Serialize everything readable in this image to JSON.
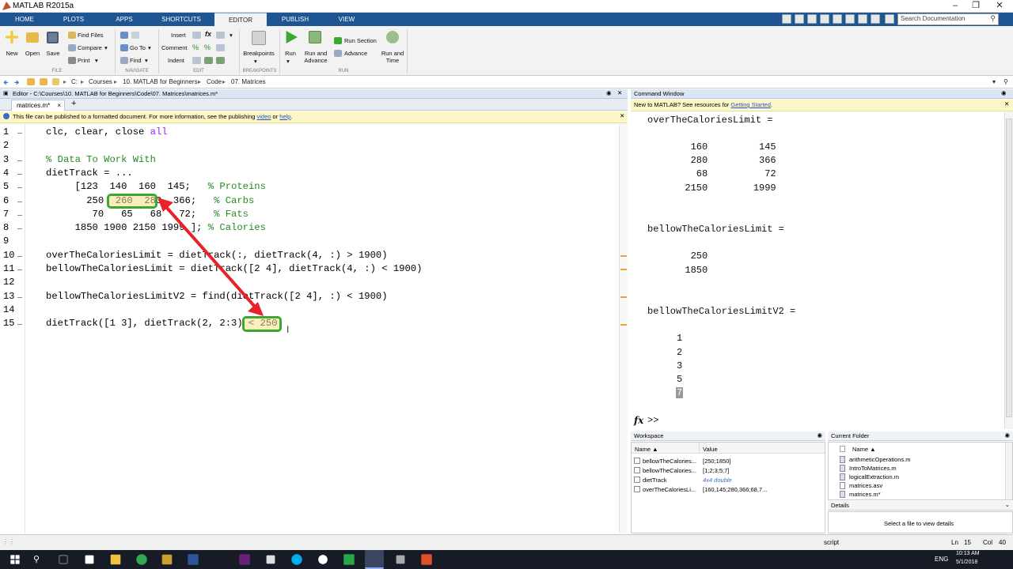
{
  "app": {
    "title": "MATLAB R2015a"
  },
  "ribbon": {
    "tabs": [
      "HOME",
      "PLOTS",
      "APPS",
      "SHORTCUTS",
      "EDITOR",
      "PUBLISH",
      "VIEW"
    ],
    "search_placeholder": "Search Documentation",
    "file": {
      "new": "New",
      "open": "Open",
      "save": "Save",
      "find_files": "Find Files",
      "compare": "Compare",
      "print": "Print",
      "group": "FILE"
    },
    "navigate": {
      "go_to": "Go To",
      "find": "Find",
      "group": "NAVIGATE"
    },
    "edit": {
      "insert": "Insert",
      "comment": "Comment",
      "indent": "Indent",
      "group": "EDIT"
    },
    "breakpoints": {
      "label": "Breakpoints",
      "group": "BREAKPOINTS"
    },
    "run": {
      "run": "Run",
      "run_and_advance": "Run and Advance",
      "run_section": "Run Section",
      "advance": "Advance",
      "run_and_time": "Run and Time",
      "group": "RUN"
    }
  },
  "address": {
    "crumbs": [
      "C:",
      "Courses",
      "10. MATLAB for Beginners",
      "Code",
      "07. Matrices"
    ]
  },
  "editor": {
    "header": "Editor - C:\\Courses\\10. MATLAB for Beginners\\Code\\07. Matrices\\matrices.m*",
    "tab": "matrices.m*",
    "info_text": "This file can be published to a formatted document. For more information, see the publishing ",
    "info_link1": "video",
    "info_or": " or ",
    "info_link2": "help",
    "info_dot": ".",
    "lines": [
      {
        "n": "1",
        "t": "clc, clear, close ",
        "s": "all"
      },
      {
        "n": "2",
        "t": ""
      },
      {
        "n": "3",
        "c": "% Data To Work With"
      },
      {
        "n": "4",
        "t": "dietTrack = ..."
      },
      {
        "n": "5",
        "t": "     [123  140  160  145;   ",
        "c": "% Proteins"
      },
      {
        "n": "6",
        "t": "       250  260  280  366;   ",
        "c": "% Carbs"
      },
      {
        "n": "7",
        "t": "        70   65   68   72;   ",
        "c": "% Fats"
      },
      {
        "n": "8",
        "t": "     1850 1900 2150 1999 ]; ",
        "c": "% Calories"
      },
      {
        "n": "9",
        "t": ""
      },
      {
        "n": "10",
        "t": "overTheCaloriesLimit = dietTrack(:, dietTrack(4, :) > 1900)"
      },
      {
        "n": "11",
        "t": "bellowTheCaloriesLimit = dietTrack([2 4], dietTrack(4, :) < 1900)"
      },
      {
        "n": "12",
        "t": ""
      },
      {
        "n": "13",
        "t": "bellowTheCaloriesLimitV2 = find(dietTrack([2 4], :) < 1900)"
      },
      {
        "n": "14",
        "t": ""
      },
      {
        "n": "15",
        "t": "dietTrack([1 3], dietTrack(2, 2:3) < 250)"
      }
    ]
  },
  "command_window": {
    "header": "Command Window",
    "info_text": "New to MATLAB? See resources for ",
    "info_link": "Getting Started",
    "info_dot": ".",
    "var1": "overTheCaloriesLimit =",
    "var1_rows": [
      "   160         145",
      "   280         366",
      "    68          72",
      "  2150        1999"
    ],
    "var2": "bellowTheCaloriesLimit =",
    "var2_rows": [
      "   250",
      "  1850"
    ],
    "var3": "bellowTheCaloriesLimitV2 =",
    "var3_rows": [
      "1",
      "2",
      "3",
      "5",
      "7"
    ],
    "prompt": ">>",
    "fx": "fx"
  },
  "workspace": {
    "header": "Workspace",
    "col_name": "Name ▲",
    "col_value": "Value",
    "rows": [
      {
        "name": "bellowTheCalories...",
        "value": "[250;1850]"
      },
      {
        "name": "bellowTheCalories...",
        "value": "[1;2;3;5;7]"
      },
      {
        "name": "dietTrack",
        "value": "4x4 double"
      },
      {
        "name": "overTheCaloriesLi...",
        "value": "[160,145;280,366;68,7..."
      }
    ]
  },
  "current_folder": {
    "header": "Current Folder",
    "col_name": "Name ▲",
    "files": [
      "arithmeticOperations.m",
      "IntroToMatrices.m",
      "logicalExtraction.m",
      "matrices.asv",
      "matrices.m*"
    ],
    "details": "Details",
    "details_hint": "Select a file to view details"
  },
  "status": {
    "mode": "script",
    "ln_label": "Ln",
    "ln": "15",
    "col_label": "Col",
    "col": "40"
  },
  "taskbar": {
    "lang": "ENG",
    "time": "10:13 AM",
    "date": "5/1/2018"
  },
  "colors": {
    "ribbon_blue": "#1e5592",
    "annotation_red": "#e8222a",
    "highlight_green": "#3aa832",
    "highlight_yellow": "#f5e08a"
  }
}
